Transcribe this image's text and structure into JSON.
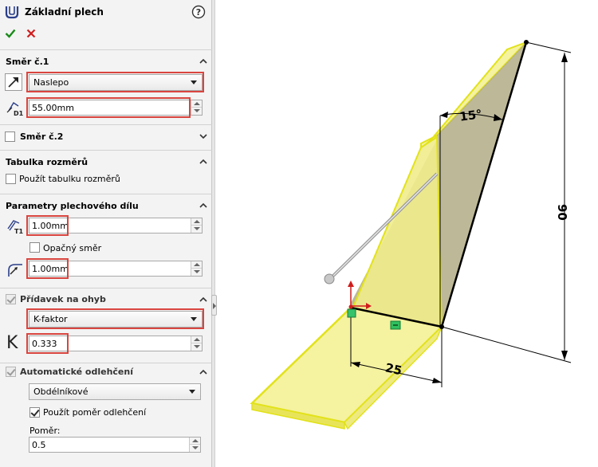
{
  "header": {
    "title": "Základní plech",
    "help_icon": "question-circle-icon",
    "ok_icon": "green-check-icon",
    "cancel_icon": "red-x-icon"
  },
  "direction1": {
    "title": "Směr č.1",
    "end_condition": "Naslepo",
    "depth": "55.00mm"
  },
  "direction2": {
    "title": "Směr č.2",
    "checked": false
  },
  "gauge_table": {
    "title": "Tabulka rozměrů",
    "use_label": "Použít tabulku rozměrů",
    "checked": false
  },
  "sheet_metal": {
    "title": "Parametry plechového dílu",
    "thickness": "1.00mm",
    "reverse_label": "Opačný směr",
    "reverse_checked": false,
    "bend_radius": "1.00mm"
  },
  "bend_allowance": {
    "title": "Přídavek na ohyb",
    "checked": true,
    "type": "K-faktor",
    "k_symbol": "K",
    "k_value": "0.333"
  },
  "auto_relief": {
    "title": "Automatické odlehčení",
    "checked": true,
    "type": "Obdélníkové",
    "use_ratio_label": "Použít poměr odlehčení",
    "use_ratio_checked": true,
    "ratio_label": "Poměr:",
    "ratio_value": "0.5"
  },
  "viewport": {
    "dim_angle": "15°",
    "dim_height": "90",
    "dim_width": "25",
    "colors": {
      "sheet_fill": "#f5f2a0",
      "sheet_edge": "#e2e21a",
      "back_face": "#b2ab86",
      "highlight_box": "#d9453f",
      "ok": "#1a8a1a",
      "cancel": "#d01c1c"
    }
  }
}
